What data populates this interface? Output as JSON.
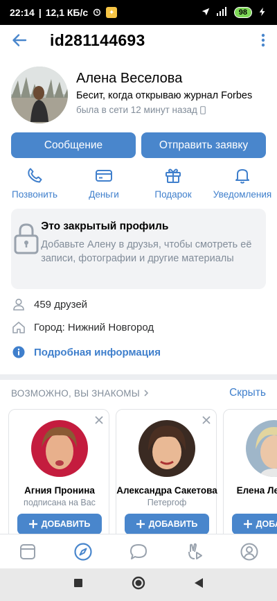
{
  "status_bar": {
    "time": "22:14",
    "speed": "12,1 КБ/с",
    "battery": "98"
  },
  "header": {
    "title": "id281144693"
  },
  "profile": {
    "name": "Алена Веселова",
    "status": "Бесит, когда открываю журнал Forbes",
    "last_seen": "была в сети 12 минут назад"
  },
  "buttons": {
    "message": "Сообщение",
    "send_request": "Отправить заявку"
  },
  "actions": [
    {
      "label": "Позвонить",
      "icon": "phone-icon"
    },
    {
      "label": "Деньги",
      "icon": "money-icon"
    },
    {
      "label": "Подарок",
      "icon": "gift-icon"
    },
    {
      "label": "Уведомления",
      "icon": "bell-icon"
    }
  ],
  "closed_profile": {
    "title": "Это закрытый профиль",
    "description": "Добавьте Алену в друзья, чтобы смотреть её записи, фотографии и другие материалы"
  },
  "info": {
    "friends": "459 друзей",
    "city": "Город: Нижний Новгород",
    "details_link": "Подробная информация"
  },
  "suggestions": {
    "title": "ВОЗМОЖНО, ВЫ ЗНАКОМЫ",
    "hide": "Скрыть",
    "add_label": "ДОБАВИТЬ",
    "people": [
      {
        "name": "Агния Пронина",
        "subtitle": "подписана на Вас"
      },
      {
        "name": "Александра Сакетова",
        "subtitle": "Петергоф"
      },
      {
        "name": "Елена Лебедева",
        "subtitle": ""
      }
    ]
  },
  "colors": {
    "accent": "#4986cc",
    "link": "#3f7fcc",
    "secondary_text": "#818c99",
    "card_bg": "#f2f3f5"
  }
}
